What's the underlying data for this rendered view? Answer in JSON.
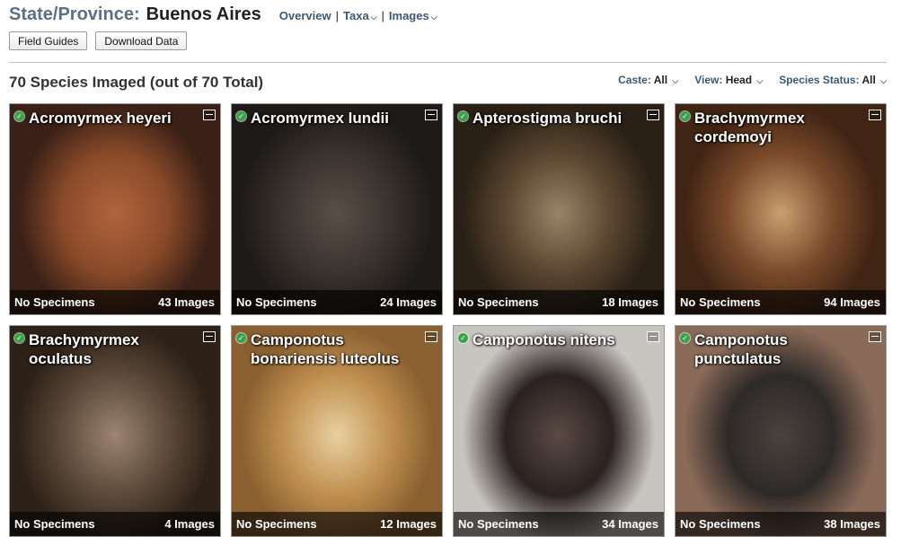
{
  "header": {
    "prefix": "State/Province:",
    "name": "Buenos Aires",
    "nav": {
      "overview": "Overview",
      "taxa": "Taxa",
      "images": "Images",
      "separator": "|"
    }
  },
  "buttons": {
    "field_guides": "Field Guides",
    "download_data": "Download Data"
  },
  "summary": "70 Species Imaged (out of 70 Total)",
  "filters": [
    {
      "label": "Caste:",
      "value": "All"
    },
    {
      "label": "View:",
      "value": "Head"
    },
    {
      "label": "Species Status:",
      "value": "All"
    }
  ],
  "cards": [
    {
      "name": "Acromyrmex heyeri",
      "specimens": "No Specimens",
      "images": "43 Images",
      "colors": [
        "#8a4a2a",
        "#b0653c",
        "#3a2016"
      ]
    },
    {
      "name": "Acromyrmex lundii",
      "specimens": "No Specimens",
      "images": "24 Images",
      "colors": [
        "#3a332e",
        "#5a4f46",
        "#1e1a17"
      ]
    },
    {
      "name": "Apterostigma bruchi",
      "specimens": "No Specimens",
      "images": "18 Images",
      "colors": [
        "#5a4630",
        "#9a8468",
        "#2a2016"
      ]
    },
    {
      "name": "Brachymyrmex cordemoyi",
      "specimens": "No Specimens",
      "images": "94 Images",
      "colors": [
        "#7a4a2a",
        "#c8a070",
        "#402414"
      ]
    },
    {
      "name": "Brachymyrmex oculatus",
      "specimens": "No Specimens",
      "images": "4 Images",
      "colors": [
        "#5c4a3a",
        "#9c8470",
        "#2e2218"
      ]
    },
    {
      "name": "Camponotus bonariensis luteolus",
      "specimens": "No Specimens",
      "images": "12 Images",
      "colors": [
        "#c09050",
        "#e8d0a0",
        "#8a6030"
      ]
    },
    {
      "name": "Camponotus nitens",
      "specimens": "No Specimens",
      "images": "34 Images",
      "colors": [
        "#2a2220",
        "#5a4a44",
        "#c8c4c0"
      ]
    },
    {
      "name": "Camponotus punctulatus",
      "specimens": "No Specimens",
      "images": "38 Images",
      "colors": [
        "#2e2a28",
        "#4a423e",
        "#8a6a58"
      ]
    }
  ]
}
